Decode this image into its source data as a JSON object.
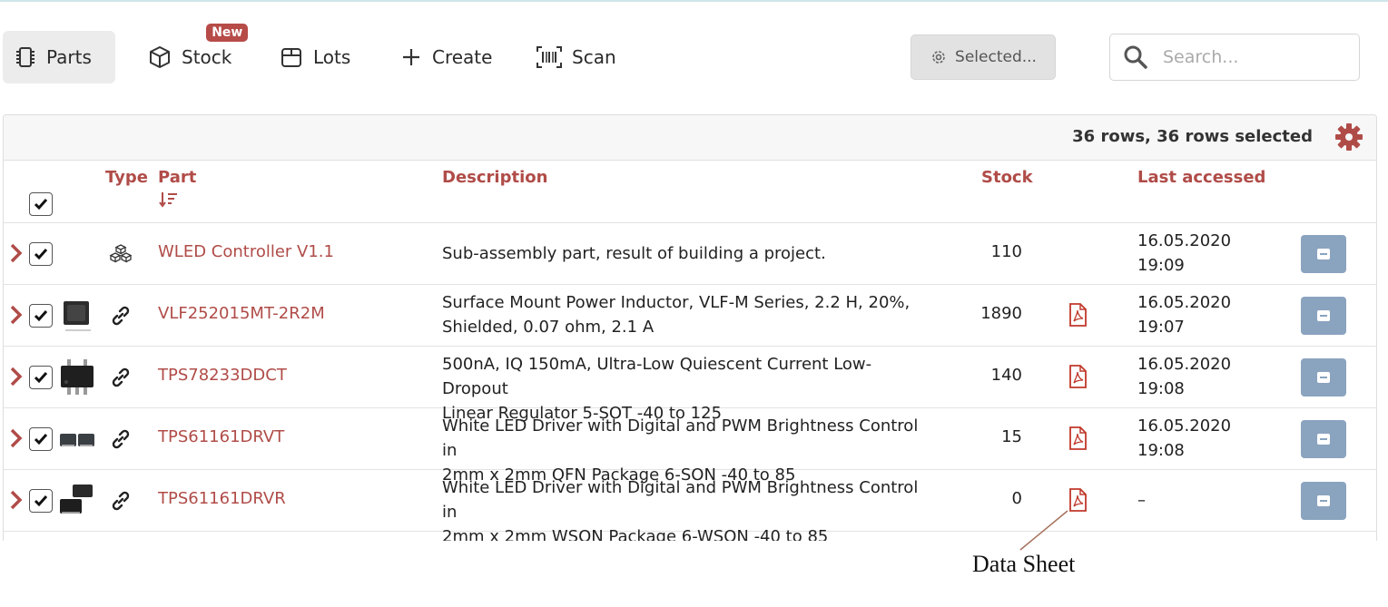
{
  "toolbar": {
    "tabs": [
      {
        "label": "Parts",
        "active": true
      },
      {
        "label": "Stock",
        "badge": "New"
      },
      {
        "label": "Lots"
      },
      {
        "label": "Create"
      },
      {
        "label": "Scan"
      }
    ],
    "selected_label": "Selected...",
    "search_placeholder": "Search..."
  },
  "table": {
    "rows_info": "36 rows, 36 rows selected",
    "headers": {
      "type": "Type",
      "part": "Part",
      "description": "Description",
      "stock": "Stock",
      "last_accessed": "Last accessed"
    },
    "rows": [
      {
        "part": "WLED Controller V1.1",
        "type_icon": "sub-assembly-icon",
        "description": [
          "Sub-assembly part, result of building a project."
        ],
        "stock": "110",
        "datasheet": false,
        "last_accessed": [
          "16.05.2020",
          "19:09"
        ]
      },
      {
        "part": "VLF252015MT-2R2M",
        "type_icon": "link-icon",
        "description": [
          "Surface Mount Power Inductor, VLF-M Series, 2.2 H, 20%,",
          "Shielded, 0.07 ohm, 2.1 A"
        ],
        "stock": "1890",
        "datasheet": true,
        "last_accessed": [
          "16.05.2020",
          "19:07"
        ]
      },
      {
        "part": "TPS78233DDCT",
        "type_icon": "link-icon",
        "description": [
          "500nA, IQ 150mA, Ultra-Low Quiescent Current Low-Dropout",
          "Linear Regulator 5-SOT -40 to 125"
        ],
        "stock": "140",
        "datasheet": true,
        "last_accessed": [
          "16.05.2020",
          "19:08"
        ]
      },
      {
        "part": "TPS61161DRVT",
        "type_icon": "link-icon",
        "description": [
          "White LED Driver with Digital and PWM Brightness Control in",
          "2mm x 2mm QFN Package 6-SON -40 to 85"
        ],
        "stock": "15",
        "datasheet": true,
        "last_accessed": [
          "16.05.2020",
          "19:08"
        ]
      },
      {
        "part": "TPS61161DRVR",
        "type_icon": "link-icon",
        "description": [
          "White LED Driver with Digital and PWM Brightness Control in",
          "2mm x 2mm WSON Package 6-WSON -40 to 85"
        ],
        "stock": "0",
        "datasheet": true,
        "last_accessed": [
          "–"
        ]
      }
    ]
  },
  "annotation": {
    "text": "Data Sheet"
  },
  "colors": {
    "accent_red": "#b04c48",
    "badge_red": "#b64b48",
    "minus_button": "#8aa3bf"
  }
}
